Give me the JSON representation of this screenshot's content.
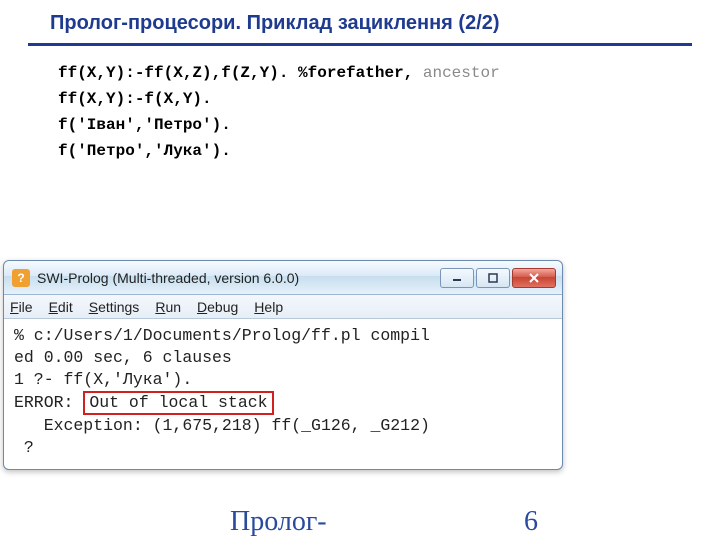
{
  "title": "Пролог-процесори. Приклад зациклення (2/2)",
  "code": {
    "l1a": "ff(X,Y):-ff(X,Z),f(Z,Y).",
    "l1b": "%forefather,",
    "l1c": " ancestor",
    "l2": "ff(X,Y):-f(X,Y).",
    "l3": "f('Іван','Петро').",
    "l4": "f('Петро','Лука')."
  },
  "window": {
    "title": "SWI-Prolog (Multi-threaded, version 6.0.0)",
    "menu": {
      "file_u": "F",
      "file_r": "ile",
      "edit_u": "E",
      "edit_r": "dit",
      "settings_u": "S",
      "settings_r": "ettings",
      "run_u": "R",
      "run_r": "un",
      "debug_u": "D",
      "debug_r": "ebug",
      "help_u": "H",
      "help_r": "elp"
    },
    "console": {
      "l1": "% c:/Users/1/Documents/Prolog/ff.pl compil",
      "l2": "ed 0.00 sec, 6 clauses",
      "l3": "1 ?- ff(X,'Лука').",
      "l4a": "ERROR: ",
      "l4b": "Out of local stack",
      "l5": "   Exception: (1,675,218) ff(_G126, _G212)",
      "l6": " ?"
    }
  },
  "footer": "Пролог-",
  "page": "6"
}
